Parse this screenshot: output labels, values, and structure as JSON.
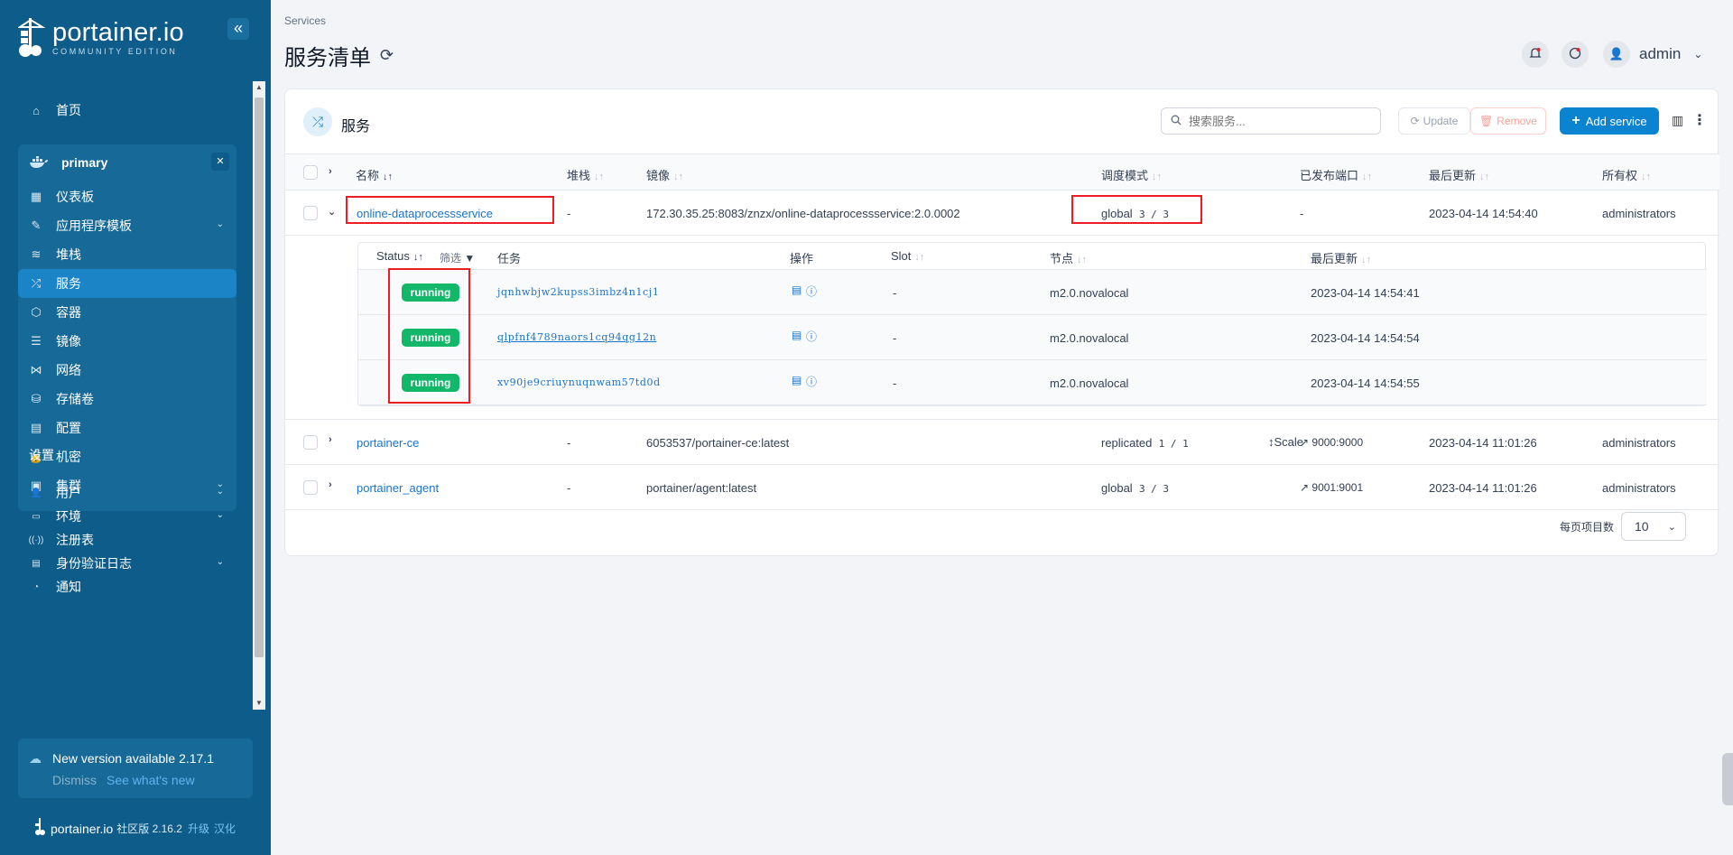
{
  "app": {
    "logo_title": "portainer.io",
    "logo_sub": "COMMUNITY EDITION",
    "collapse_icon": "«"
  },
  "sidebar": {
    "home": "首页",
    "environment": {
      "name": "primary",
      "items": [
        {
          "label": "仪表板",
          "icon": "dashboard-icon",
          "glyph": "▦",
          "chevron": false
        },
        {
          "label": "应用程序模板",
          "icon": "rocket-icon",
          "glyph": "✎",
          "chevron": true
        },
        {
          "label": "堆栈",
          "icon": "layers-icon",
          "glyph": "≋",
          "chevron": false
        },
        {
          "label": "服务",
          "icon": "shuffle-icon",
          "glyph": "⤮",
          "chevron": false,
          "active": true
        },
        {
          "label": "容器",
          "icon": "box-icon",
          "glyph": "⬡",
          "chevron": false
        },
        {
          "label": "镜像",
          "icon": "list-icon",
          "glyph": "☰",
          "chevron": false
        },
        {
          "label": "网络",
          "icon": "share-icon",
          "glyph": "⋈",
          "chevron": false
        },
        {
          "label": "存储卷",
          "icon": "database-icon",
          "glyph": "⛁",
          "chevron": false
        },
        {
          "label": "配置",
          "icon": "clipboard-icon",
          "glyph": "▤",
          "chevron": false
        },
        {
          "label": "机密",
          "icon": "lock-icon",
          "glyph": "🔒",
          "chevron": false
        },
        {
          "label": "集群",
          "icon": "cluster-icon",
          "glyph": "▣",
          "chevron": true
        }
      ]
    },
    "settings_label": "设置",
    "settings_items": [
      {
        "label": "用户",
        "icon": "users-icon",
        "glyph": "👤",
        "chevron": true
      },
      {
        "label": "环境",
        "icon": "hdd-icon",
        "glyph": "▭",
        "chevron": true
      },
      {
        "label": "注册表",
        "icon": "radio-icon",
        "glyph": "((·))",
        "chevron": false
      },
      {
        "label": "身份验证日志",
        "icon": "log-icon",
        "glyph": "▤",
        "chevron": true
      },
      {
        "label": "通知",
        "icon": "bell-icon",
        "glyph": "◔",
        "chevron": false
      }
    ],
    "update": {
      "title": "New version available 2.17.1",
      "dismiss": "Dismiss",
      "see_new": "See what's new"
    },
    "footer": {
      "brand": "portainer.io",
      "version": "社区版 2.16.2",
      "upgrade": "升级",
      "localize": "汉化"
    }
  },
  "header": {
    "breadcrumb": "Services",
    "title": "服务清单",
    "user": "admin"
  },
  "card": {
    "title": "服务",
    "search_placeholder": "搜索服务...",
    "update_label": "Update",
    "remove_label": "Remove",
    "add_label": "Add service",
    "columns": [
      "名称",
      "堆栈",
      "镜像",
      "调度模式",
      "已发布端口",
      "最后更新",
      "所有权"
    ],
    "services": [
      {
        "name": "online-dataprocessservice",
        "stack": "-",
        "image": "172.30.35.25:8083/znzx/online-dataprocessservice:2.0.0002",
        "mode": "global",
        "replicas": "3 / 3",
        "scale": "",
        "ports": "-",
        "updated": "2023-04-14 14:54:40",
        "ownership": "administrators",
        "expanded": true
      },
      {
        "name": "portainer-ce",
        "stack": "-",
        "image": "6053537/portainer-ce:latest",
        "mode": "replicated",
        "replicas": "1 / 1",
        "scale": "Scale",
        "ports": "9000:9000",
        "updated": "2023-04-14 11:01:26",
        "ownership": "administrators",
        "expanded": false
      },
      {
        "name": "portainer_agent",
        "stack": "-",
        "image": "portainer/agent:latest",
        "mode": "global",
        "replicas": "3 / 3",
        "scale": "",
        "ports": "9001:9001",
        "updated": "2023-04-14 11:01:26",
        "ownership": "administrators",
        "expanded": false
      }
    ],
    "tasks": {
      "columns": [
        "Status",
        "筛选",
        "任务",
        "操作",
        "Slot",
        "节点",
        "最后更新"
      ],
      "rows": [
        {
          "status": "running",
          "task": "jqnhwbjw2kupss3imbz4n1cj1",
          "slot": "-",
          "node": "m2.0.novalocal",
          "updated": "2023-04-14 14:54:41"
        },
        {
          "status": "running",
          "task": "qlpfnf4789naors1cq94qg12n",
          "slot": "-",
          "node": "m2.0.novalocal",
          "updated": "2023-04-14 14:54:54"
        },
        {
          "status": "running",
          "task": "xv90je9criuynuqnwam57td0d",
          "slot": "-",
          "node": "m2.0.novalocal",
          "updated": "2023-04-14 14:54:55"
        }
      ]
    },
    "pager": {
      "label": "每页项目数",
      "value": "10"
    }
  },
  "colors": {
    "sidebar": "#0e5c8a",
    "accent": "#0a84d0",
    "running": "#12b76a",
    "highlight": "#ee1c25"
  }
}
